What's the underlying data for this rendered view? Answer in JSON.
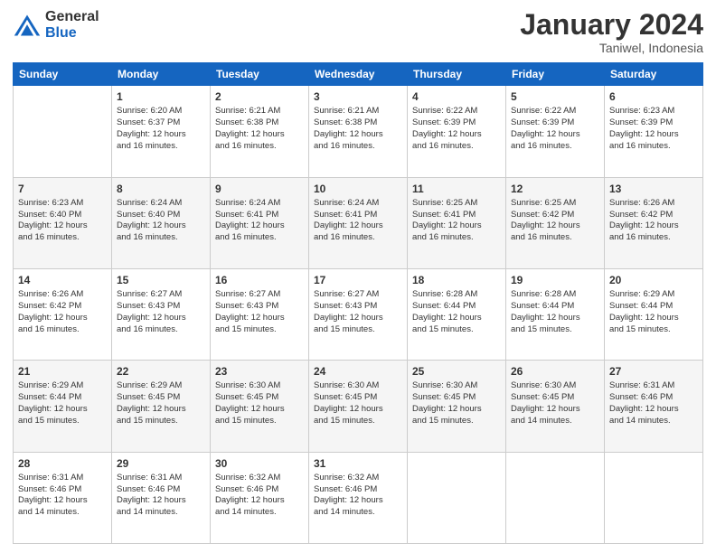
{
  "logo": {
    "general": "General",
    "blue": "Blue"
  },
  "title": {
    "month": "January 2024",
    "location": "Taniwel, Indonesia"
  },
  "days_of_week": [
    "Sunday",
    "Monday",
    "Tuesday",
    "Wednesday",
    "Thursday",
    "Friday",
    "Saturday"
  ],
  "weeks": [
    [
      {
        "day": "",
        "info": ""
      },
      {
        "day": "1",
        "info": "Sunrise: 6:20 AM\nSunset: 6:37 PM\nDaylight: 12 hours\nand 16 minutes."
      },
      {
        "day": "2",
        "info": "Sunrise: 6:21 AM\nSunset: 6:38 PM\nDaylight: 12 hours\nand 16 minutes."
      },
      {
        "day": "3",
        "info": "Sunrise: 6:21 AM\nSunset: 6:38 PM\nDaylight: 12 hours\nand 16 minutes."
      },
      {
        "day": "4",
        "info": "Sunrise: 6:22 AM\nSunset: 6:39 PM\nDaylight: 12 hours\nand 16 minutes."
      },
      {
        "day": "5",
        "info": "Sunrise: 6:22 AM\nSunset: 6:39 PM\nDaylight: 12 hours\nand 16 minutes."
      },
      {
        "day": "6",
        "info": "Sunrise: 6:23 AM\nSunset: 6:39 PM\nDaylight: 12 hours\nand 16 minutes."
      }
    ],
    [
      {
        "day": "7",
        "info": "Sunrise: 6:23 AM\nSunset: 6:40 PM\nDaylight: 12 hours\nand 16 minutes."
      },
      {
        "day": "8",
        "info": "Sunrise: 6:24 AM\nSunset: 6:40 PM\nDaylight: 12 hours\nand 16 minutes."
      },
      {
        "day": "9",
        "info": "Sunrise: 6:24 AM\nSunset: 6:41 PM\nDaylight: 12 hours\nand 16 minutes."
      },
      {
        "day": "10",
        "info": "Sunrise: 6:24 AM\nSunset: 6:41 PM\nDaylight: 12 hours\nand 16 minutes."
      },
      {
        "day": "11",
        "info": "Sunrise: 6:25 AM\nSunset: 6:41 PM\nDaylight: 12 hours\nand 16 minutes."
      },
      {
        "day": "12",
        "info": "Sunrise: 6:25 AM\nSunset: 6:42 PM\nDaylight: 12 hours\nand 16 minutes."
      },
      {
        "day": "13",
        "info": "Sunrise: 6:26 AM\nSunset: 6:42 PM\nDaylight: 12 hours\nand 16 minutes."
      }
    ],
    [
      {
        "day": "14",
        "info": "Sunrise: 6:26 AM\nSunset: 6:42 PM\nDaylight: 12 hours\nand 16 minutes."
      },
      {
        "day": "15",
        "info": "Sunrise: 6:27 AM\nSunset: 6:43 PM\nDaylight: 12 hours\nand 16 minutes."
      },
      {
        "day": "16",
        "info": "Sunrise: 6:27 AM\nSunset: 6:43 PM\nDaylight: 12 hours\nand 15 minutes."
      },
      {
        "day": "17",
        "info": "Sunrise: 6:27 AM\nSunset: 6:43 PM\nDaylight: 12 hours\nand 15 minutes."
      },
      {
        "day": "18",
        "info": "Sunrise: 6:28 AM\nSunset: 6:44 PM\nDaylight: 12 hours\nand 15 minutes."
      },
      {
        "day": "19",
        "info": "Sunrise: 6:28 AM\nSunset: 6:44 PM\nDaylight: 12 hours\nand 15 minutes."
      },
      {
        "day": "20",
        "info": "Sunrise: 6:29 AM\nSunset: 6:44 PM\nDaylight: 12 hours\nand 15 minutes."
      }
    ],
    [
      {
        "day": "21",
        "info": "Sunrise: 6:29 AM\nSunset: 6:44 PM\nDaylight: 12 hours\nand 15 minutes."
      },
      {
        "day": "22",
        "info": "Sunrise: 6:29 AM\nSunset: 6:45 PM\nDaylight: 12 hours\nand 15 minutes."
      },
      {
        "day": "23",
        "info": "Sunrise: 6:30 AM\nSunset: 6:45 PM\nDaylight: 12 hours\nand 15 minutes."
      },
      {
        "day": "24",
        "info": "Sunrise: 6:30 AM\nSunset: 6:45 PM\nDaylight: 12 hours\nand 15 minutes."
      },
      {
        "day": "25",
        "info": "Sunrise: 6:30 AM\nSunset: 6:45 PM\nDaylight: 12 hours\nand 15 minutes."
      },
      {
        "day": "26",
        "info": "Sunrise: 6:30 AM\nSunset: 6:45 PM\nDaylight: 12 hours\nand 14 minutes."
      },
      {
        "day": "27",
        "info": "Sunrise: 6:31 AM\nSunset: 6:46 PM\nDaylight: 12 hours\nand 14 minutes."
      }
    ],
    [
      {
        "day": "28",
        "info": "Sunrise: 6:31 AM\nSunset: 6:46 PM\nDaylight: 12 hours\nand 14 minutes."
      },
      {
        "day": "29",
        "info": "Sunrise: 6:31 AM\nSunset: 6:46 PM\nDaylight: 12 hours\nand 14 minutes."
      },
      {
        "day": "30",
        "info": "Sunrise: 6:32 AM\nSunset: 6:46 PM\nDaylight: 12 hours\nand 14 minutes."
      },
      {
        "day": "31",
        "info": "Sunrise: 6:32 AM\nSunset: 6:46 PM\nDaylight: 12 hours\nand 14 minutes."
      },
      {
        "day": "",
        "info": ""
      },
      {
        "day": "",
        "info": ""
      },
      {
        "day": "",
        "info": ""
      }
    ]
  ]
}
